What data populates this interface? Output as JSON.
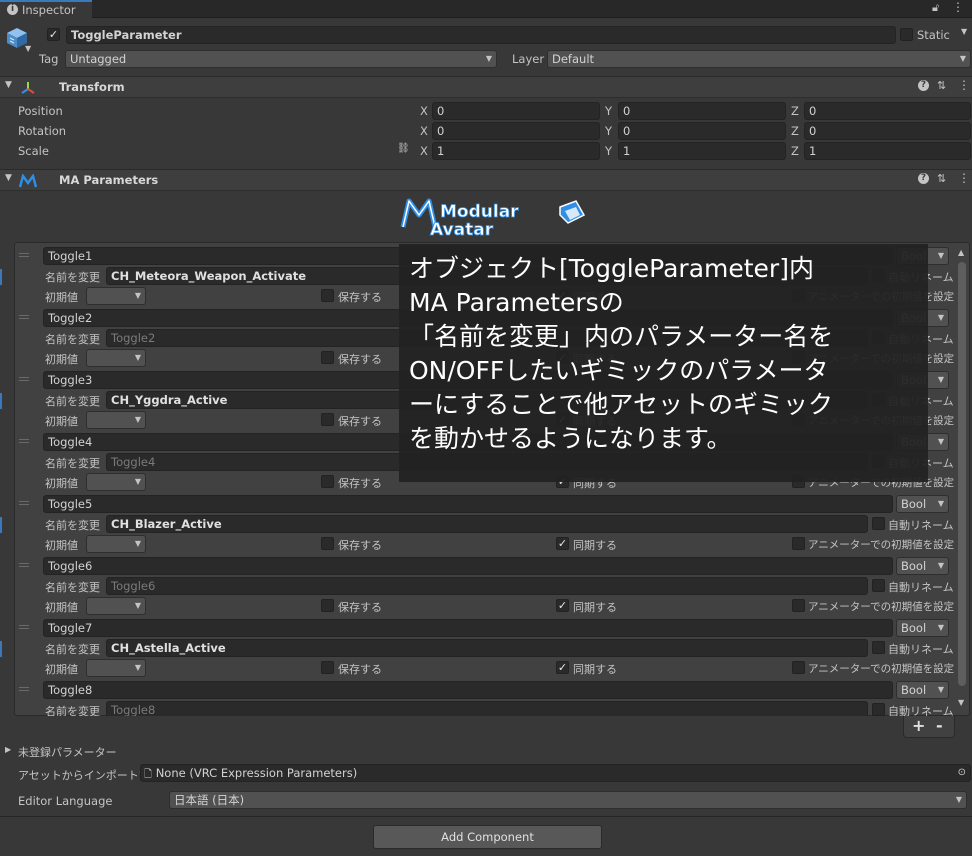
{
  "tab": {
    "title": "Inspector"
  },
  "object": {
    "active": true,
    "name": "ToggleParameter",
    "static_label": "Static",
    "tag_label": "Tag",
    "tag_value": "Untagged",
    "layer_label": "Layer",
    "layer_value": "Default"
  },
  "transform": {
    "title": "Transform",
    "rows": [
      {
        "label": "Position",
        "x": "0",
        "y": "0",
        "z": "0"
      },
      {
        "label": "Rotation",
        "x": "0",
        "y": "0",
        "z": "0"
      },
      {
        "label": "Scale",
        "x": "1",
        "y": "1",
        "z": "1"
      }
    ],
    "axis": {
      "x": "X",
      "y": "Y",
      "z": "Z"
    }
  },
  "ma": {
    "title": "MA Parameters",
    "logo_line1": "Modular",
    "logo_line2": "Avatar",
    "labels": {
      "rename": "名前を変更",
      "initial": "初期値",
      "save": "保存する",
      "sync": "同期する",
      "auto_rename": "自動リネーム",
      "animator_default": "アニメーターでの初期値を設定",
      "type": "Bool"
    },
    "params": [
      {
        "name": "Toggle1",
        "rename": "CH_Meteora_Weapon_Activate",
        "rename_is_placeholder": false,
        "synced": true
      },
      {
        "name": "Toggle2",
        "rename": "Toggle2",
        "rename_is_placeholder": true,
        "synced": true
      },
      {
        "name": "Toggle3",
        "rename": "CH_Yggdra_Active",
        "rename_is_placeholder": false,
        "synced": true
      },
      {
        "name": "Toggle4",
        "rename": "Toggle4",
        "rename_is_placeholder": true,
        "synced": true
      },
      {
        "name": "Toggle5",
        "rename": "CH_Blazer_Active",
        "rename_is_placeholder": false,
        "synced": true
      },
      {
        "name": "Toggle6",
        "rename": "Toggle6",
        "rename_is_placeholder": true,
        "synced": true
      },
      {
        "name": "Toggle7",
        "rename": "CH_Astella_Active",
        "rename_is_placeholder": false,
        "synced": true
      },
      {
        "name": "Toggle8",
        "rename": "Toggle8",
        "rename_is_placeholder": true,
        "synced": true
      }
    ],
    "add_button": "+",
    "remove_button": "-",
    "unregistered": "未登録パラメーター",
    "import_label": "アセットからインポートする",
    "import_value": "None (VRC Expression Parameters)",
    "language_label": "Editor Language",
    "language_value": "日本語 (日本)"
  },
  "add_component": "Add Component",
  "overlay": {
    "lines": [
      "オブジェクト[ToggleParameter]内",
      "MA Parametersの",
      "「名前を変更」内のパラメーター名を",
      "ON/OFFしたいギミックのパラメータ",
      "ーにすることで他アセットのギミック",
      "を動かせるようになります。"
    ]
  },
  "colors": {
    "accent": "#3a79bb",
    "logo": "#2f8fe6",
    "field": "#2a2a2a",
    "panel": "#383838"
  }
}
